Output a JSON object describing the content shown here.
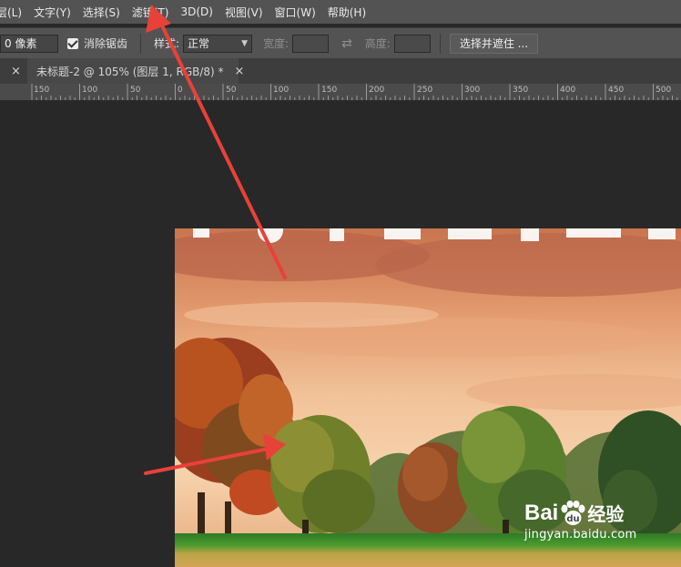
{
  "menubar": {
    "items": [
      "层(L)",
      "文字(Y)",
      "选择(S)",
      "滤镜(T)",
      "3D(D)",
      "视图(V)",
      "窗口(W)",
      "帮助(H)"
    ]
  },
  "options": {
    "feather_value": "0 像素",
    "antialias_label": "消除锯齿",
    "style_label": "样式:",
    "style_value": "正常",
    "width_label": "宽度:",
    "height_label": "高度:",
    "select_mask_button": "选择并遮住 ..."
  },
  "tabs": {
    "prev_close": "×",
    "active_title": "未标题-2 @ 105% (图层 1, RGB/8) *",
    "active_close": "×"
  },
  "ruler": {
    "labels": [
      "150",
      "100",
      "50",
      "0",
      "50",
      "100",
      "150",
      "200",
      "250",
      "300",
      "350",
      "400",
      "450",
      "500"
    ]
  },
  "watermark": {
    "brand": "Bai",
    "brand_suffix": "经验",
    "url": "jingyan.baidu.com"
  },
  "colors": {
    "annotation_arrow": "#e8413a",
    "app_background": "#282828",
    "menubar": "#535353"
  }
}
